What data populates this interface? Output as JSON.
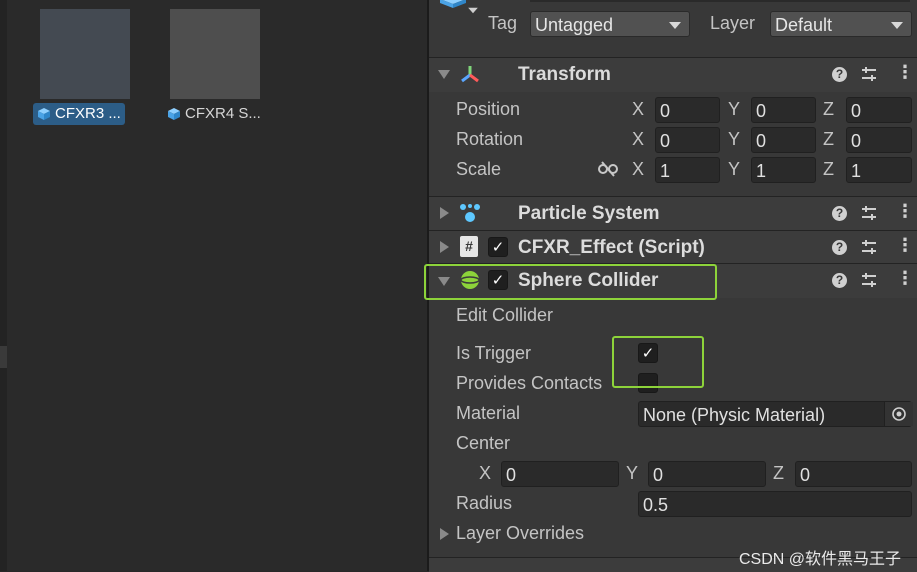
{
  "project": {
    "assets": [
      {
        "label": "CFXR3 ...",
        "selected": true,
        "icon": "prefab-cube-icon"
      },
      {
        "label": "CFXR4 S...",
        "selected": false,
        "icon": "prefab-cube-icon"
      }
    ]
  },
  "inspector": {
    "tag_label": "Tag",
    "tag_value": "Untagged",
    "layer_label": "Layer",
    "layer_value": "Default",
    "transform": {
      "title": "Transform",
      "rows": [
        {
          "label": "Position",
          "x": "0",
          "y": "0",
          "z": "0"
        },
        {
          "label": "Rotation",
          "x": "0",
          "y": "0",
          "z": "0"
        },
        {
          "label": "Scale",
          "x": "1",
          "y": "1",
          "z": "1"
        }
      ],
      "axis_x": "X",
      "axis_y": "Y",
      "axis_z": "Z"
    },
    "components": {
      "particle_system": "Particle System",
      "cfxr_effect": "CFXR_Effect (Script)",
      "sphere_collider": "Sphere Collider"
    },
    "sphere_collider": {
      "edit_collider": "Edit Collider",
      "is_trigger_label": "Is Trigger",
      "is_trigger_checked": true,
      "provides_contacts_label": "Provides Contacts",
      "provides_contacts_checked": false,
      "material_label": "Material",
      "material_value": "None (Physic Material)",
      "center_label": "Center",
      "center": {
        "x": "0",
        "y": "0",
        "z": "0"
      },
      "radius_label": "Radius",
      "radius_value": "0.5",
      "layer_overrides": "Layer Overrides"
    },
    "help_glyph": "?",
    "checkmark": "✓"
  },
  "watermark": "CSDN @软件黑马王子",
  "colors": {
    "highlight": "#8dd33a",
    "selection": "#2c5d87"
  }
}
